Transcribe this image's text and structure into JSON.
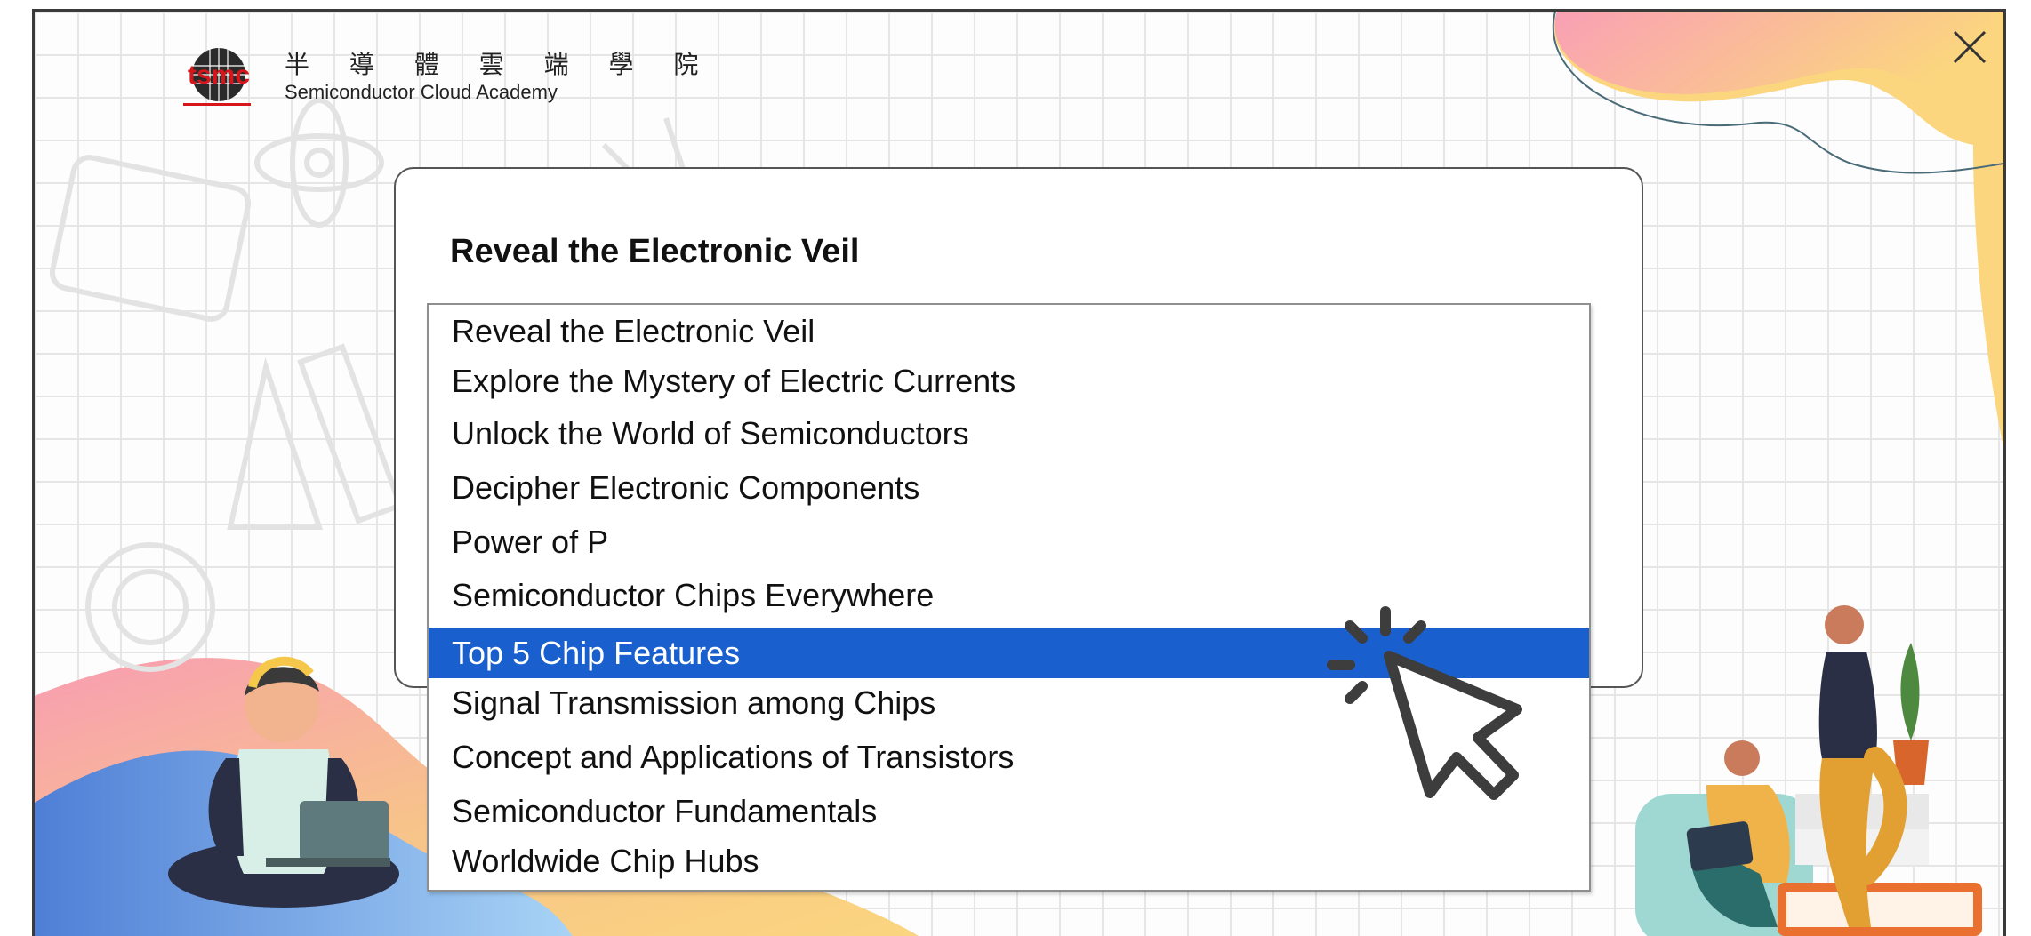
{
  "logo": {
    "mark": "tsmc",
    "title_zh": "半 導 體 雲 端 學 院",
    "title_en": "Semiconductor Cloud Academy"
  },
  "dialog": {
    "close_icon": "close-icon",
    "select": {
      "current_value": "Reveal the Electronic Veil",
      "options": [
        "Reveal the Electronic Veil",
        "Explore the Mystery of Electric Currents",
        "Unlock the World of Semiconductors",
        "Decipher Electronic Components",
        "Power of P",
        "Semiconductor Chips Everywhere",
        "Top 5 Chip Features",
        "Signal Transmission among Chips",
        "Concept and Applications of Transistors",
        "Semiconductor Fundamentals",
        "Worldwide Chip Hubs"
      ],
      "highlighted_option": "Top 5 Chip Features"
    }
  },
  "colors": {
    "highlight": "#1a5fce",
    "frame_border": "#3a3a3a",
    "logo_red": "#d6161b"
  },
  "icons": [
    "tsmc-logo-icon",
    "close-icon",
    "click-cursor-icon"
  ]
}
